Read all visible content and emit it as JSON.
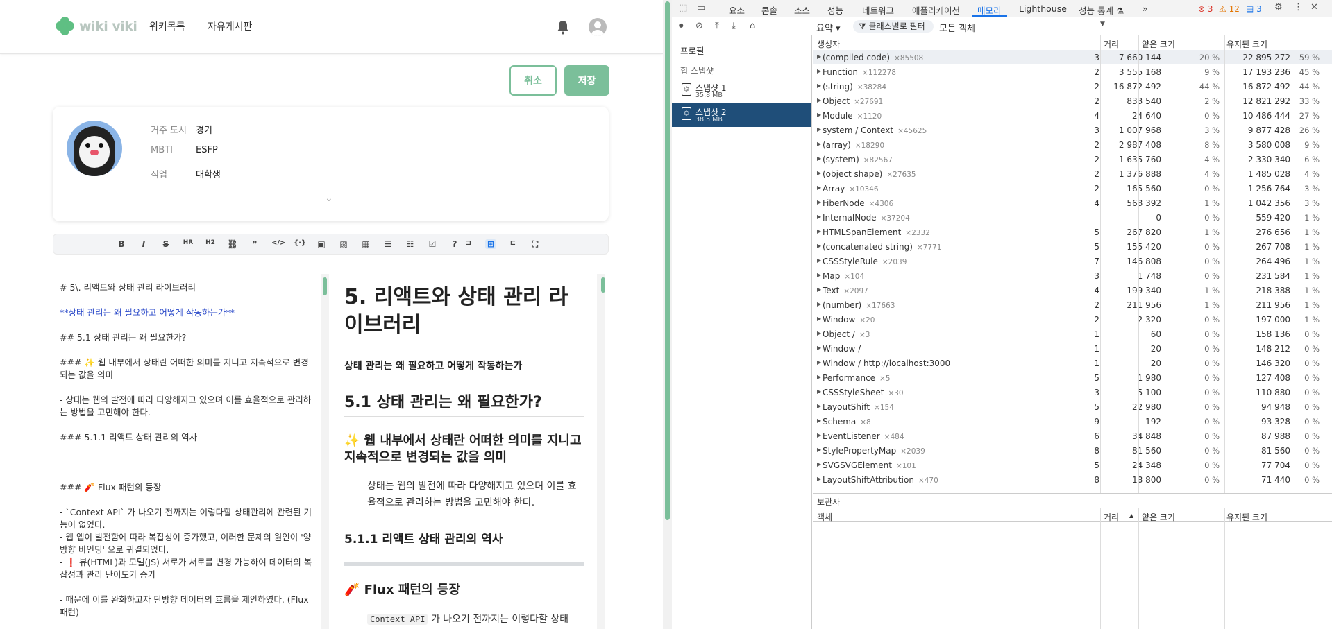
{
  "app": {
    "logo_text": "wiki viki",
    "nav": [
      "위키목록",
      "자유게시판"
    ]
  },
  "actions": {
    "cancel": "취소",
    "save": "저장"
  },
  "profile": {
    "fields": [
      {
        "label": "거주 도시",
        "value": "경기"
      },
      {
        "label": "MBTI",
        "value": "ESFP"
      },
      {
        "label": "직업",
        "value": "대학생"
      }
    ]
  },
  "toolbar": {
    "items": [
      "bold-icon",
      "italic-icon",
      "strikethrough-icon",
      "heading-icon",
      "heading-alt-icon",
      "link-icon",
      "quote-icon",
      "code-icon",
      "code-block-icon",
      "comment-icon",
      "image-icon",
      "table-icon",
      "unordered-list-icon",
      "ordered-list-icon",
      "checklist-icon",
      "help-icon",
      "live-view-icon",
      "split-view-icon",
      "preview-icon",
      "fullscreen-icon"
    ]
  },
  "editor": {
    "lines": [
      "# 5\\. 리액트와 상태 관리 라이브러리",
      "**상태 관리는 왜 필요하고 어떻게 작동하는가**",
      "## 5.1 상태 관리는 왜 필요한가?",
      "### ✨ 웹 내부에서 상태란 어떠한 의미를 지니고 지속적으로 변경되는 값을 의미",
      "-   상태는 웹의 발전에 따라 다양해지고 있으며 이를 효율적으로 관리하는 방법을 고민해야 한다.",
      "### 5.1.1 리액트 상태 관리의 역사",
      "---",
      "### 🧨 Flux 패턴의 등장",
      "-   `Context API` 가 나오기 전까지는 이렇다할 상태관리에 관련된 기능이 없었다.",
      "-   웹 앱이 발전함에 따라 복잡성이 증가했고, 이러한 문제의 원인이 '양방향 바인딩' 으로 귀결되었다.",
      "-   ❗ 뷰(HTML)과 모델(JS) 서로가 서로를 변경 가능하여 데이터의 복잡성과 관리 난이도가 증가",
      "-   때문에 이를 완화하고자 단방향 데이터의 흐름을 제안하였다. (Flux 패턴)"
    ]
  },
  "preview": {
    "h1": "5. 리액트와 상태 관리 라이브러리",
    "strong": "상태 관리는 왜 필요하고 어떻게 작동하는가",
    "h2": "5.1 상태 관리는 왜 필요한가?",
    "h3": "✨ 웹 내부에서 상태란 어떠한 의미를 지니고 지속적으로 변경되는 값을 의미",
    "p1": "상태는 웹의 발전에 따라 다양해지고 있으며 이를 효율적으로 관리하는 방법을 고민해야 한다.",
    "h4": "5.1.1 리액트 상태 관리의 역사",
    "h3b": "🧨 Flux 패턴의 등장",
    "code": "Context API",
    "p2": "가 나오기 전까지는 이렇다할 상태"
  },
  "devtools": {
    "tabs": [
      "요소",
      "콘솔",
      "소스",
      "성능",
      "네트워크",
      "애플리케이션",
      "메모리",
      "Lighthouse",
      "성능 통계 ⚗",
      "»"
    ],
    "active_tab": "메모리",
    "badges": {
      "errors": "3",
      "warnings": "12",
      "info": "3"
    },
    "summary_select": "요약 ▾",
    "filter_label": "클래스별로 필터",
    "objects_select": "모든 객체",
    "profiles_label": "프로필",
    "heap_label": "힙 스냅샷",
    "snapshots": [
      {
        "name": "스냅샷 1",
        "size": "35.8 MB"
      },
      {
        "name": "스냅샷 2",
        "size": "38.5 MB"
      }
    ],
    "columns": [
      "생성자",
      "거리",
      "얕은 크기",
      "유지된 크기"
    ],
    "rows": [
      {
        "name": "(compiled code)",
        "count": "×85508",
        "dist": "3",
        "shallow": "7 660 144",
        "sp": "20 %",
        "retained": "22 895 272",
        "rp": "59 %"
      },
      {
        "name": "Function",
        "count": "×112278",
        "dist": "2",
        "shallow": "3 555 168",
        "sp": "9 %",
        "retained": "17 193 236",
        "rp": "45 %"
      },
      {
        "name": "(string)",
        "count": "×38284",
        "dist": "2",
        "shallow": "16 872 492",
        "sp": "44 %",
        "retained": "16 872 492",
        "rp": "44 %"
      },
      {
        "name": "Object",
        "count": "×27691",
        "dist": "2",
        "shallow": "833 540",
        "sp": "2 %",
        "retained": "12 821 292",
        "rp": "33 %"
      },
      {
        "name": "Module",
        "count": "×1120",
        "dist": "4",
        "shallow": "24 640",
        "sp": "0 %",
        "retained": "10 486 444",
        "rp": "27 %"
      },
      {
        "name": "system / Context",
        "count": "×45625",
        "dist": "3",
        "shallow": "1 007 968",
        "sp": "3 %",
        "retained": "9 877 428",
        "rp": "26 %"
      },
      {
        "name": "(array)",
        "count": "×18290",
        "dist": "2",
        "shallow": "2 987 408",
        "sp": "8 %",
        "retained": "3 580 008",
        "rp": "9 %"
      },
      {
        "name": "(system)",
        "count": "×82567",
        "dist": "2",
        "shallow": "1 635 760",
        "sp": "4 %",
        "retained": "2 330 340",
        "rp": "6 %"
      },
      {
        "name": "(object shape)",
        "count": "×27635",
        "dist": "2",
        "shallow": "1 376 888",
        "sp": "4 %",
        "retained": "1 485 028",
        "rp": "4 %"
      },
      {
        "name": "Array",
        "count": "×10346",
        "dist": "2",
        "shallow": "165 560",
        "sp": "0 %",
        "retained": "1 256 764",
        "rp": "3 %"
      },
      {
        "name": "FiberNode",
        "count": "×4306",
        "dist": "4",
        "shallow": "568 392",
        "sp": "1 %",
        "retained": "1 042 356",
        "rp": "3 %"
      },
      {
        "name": "InternalNode",
        "count": "×37204",
        "dist": "–",
        "shallow": "0",
        "sp": "0 %",
        "retained": "559 420",
        "rp": "1 %"
      },
      {
        "name": "HTMLSpanElement",
        "count": "×2332",
        "dist": "5",
        "shallow": "267 820",
        "sp": "1 %",
        "retained": "276 656",
        "rp": "1 %"
      },
      {
        "name": "(concatenated string)",
        "count": "×7771",
        "dist": "5",
        "shallow": "155 420",
        "sp": "0 %",
        "retained": "267 708",
        "rp": "1 %"
      },
      {
        "name": "CSSStyleRule",
        "count": "×2039",
        "dist": "7",
        "shallow": "146 808",
        "sp": "0 %",
        "retained": "264 496",
        "rp": "1 %"
      },
      {
        "name": "Map",
        "count": "×104",
        "dist": "3",
        "shallow": "1 748",
        "sp": "0 %",
        "retained": "231 584",
        "rp": "1 %"
      },
      {
        "name": "Text",
        "count": "×2097",
        "dist": "4",
        "shallow": "199 340",
        "sp": "1 %",
        "retained": "218 388",
        "rp": "1 %"
      },
      {
        "name": "(number)",
        "count": "×17663",
        "dist": "2",
        "shallow": "211 956",
        "sp": "1 %",
        "retained": "211 956",
        "rp": "1 %"
      },
      {
        "name": "Window",
        "count": "×20",
        "dist": "2",
        "shallow": "2 320",
        "sp": "0 %",
        "retained": "197 000",
        "rp": "1 %"
      },
      {
        "name": "Object /",
        "count": "×3",
        "dist": "1",
        "shallow": "60",
        "sp": "0 %",
        "retained": "158 136",
        "rp": "0 %"
      },
      {
        "name": "Window /",
        "count": "",
        "dist": "1",
        "shallow": "20",
        "sp": "0 %",
        "retained": "148 212",
        "rp": "0 %"
      },
      {
        "name": "Window / http://localhost:3000",
        "count": "",
        "dist": "1",
        "shallow": "20",
        "sp": "0 %",
        "retained": "146 320",
        "rp": "0 %"
      },
      {
        "name": "Performance",
        "count": "×5",
        "dist": "5",
        "shallow": "1 980",
        "sp": "0 %",
        "retained": "127 408",
        "rp": "0 %"
      },
      {
        "name": "CSSStyleSheet",
        "count": "×30",
        "dist": "3",
        "shallow": "5 100",
        "sp": "0 %",
        "retained": "110 880",
        "rp": "0 %"
      },
      {
        "name": "LayoutShift",
        "count": "×154",
        "dist": "5",
        "shallow": "22 980",
        "sp": "0 %",
        "retained": "94 948",
        "rp": "0 %"
      },
      {
        "name": "Schema",
        "count": "×8",
        "dist": "9",
        "shallow": "192",
        "sp": "0 %",
        "retained": "93 328",
        "rp": "0 %"
      },
      {
        "name": "EventListener",
        "count": "×484",
        "dist": "6",
        "shallow": "34 848",
        "sp": "0 %",
        "retained": "87 988",
        "rp": "0 %"
      },
      {
        "name": "StylePropertyMap",
        "count": "×2039",
        "dist": "8",
        "shallow": "81 560",
        "sp": "0 %",
        "retained": "81 560",
        "rp": "0 %"
      },
      {
        "name": "SVGSVGElement",
        "count": "×101",
        "dist": "5",
        "shallow": "24 348",
        "sp": "0 %",
        "retained": "77 704",
        "rp": "0 %"
      },
      {
        "name": "LayoutShiftAttribution",
        "count": "×470",
        "dist": "8",
        "shallow": "18 800",
        "sp": "0 %",
        "retained": "71 440",
        "rp": "0 %"
      }
    ],
    "retainers_label": "보관자",
    "retainer_columns": [
      "객체",
      "거리",
      "얕은 크기",
      "유지된 크기"
    ]
  }
}
